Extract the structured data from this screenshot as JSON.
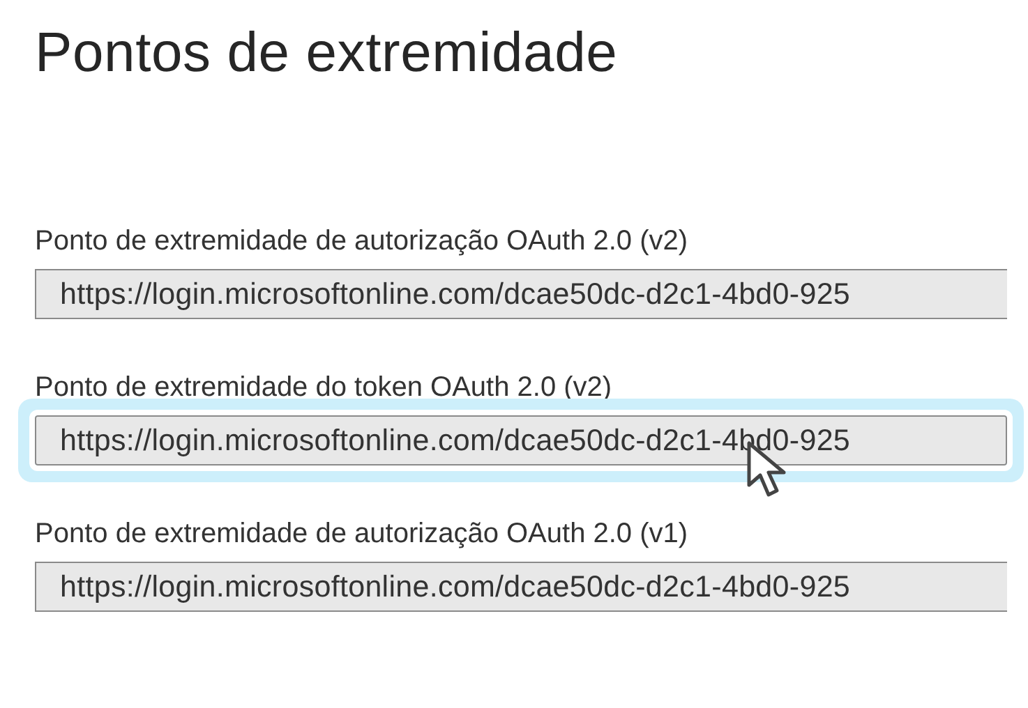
{
  "title": "Pontos de extremidade",
  "endpoints": [
    {
      "label": "Ponto de extremidade de autorização OAuth 2.0 (v2)",
      "value": "https://login.microsoftonline.com/dcae50dc-d2c1-4bd0-925",
      "focused": false
    },
    {
      "label": "Ponto de extremidade do token OAuth 2.0 (v2)",
      "value": "https://login.microsoftonline.com/dcae50dc-d2c1-4bd0-925",
      "focused": true
    },
    {
      "label": "Ponto de extremidade de autorização OAuth 2.0 (v1)",
      "value": "https://login.microsoftonline.com/dcae50dc-d2c1-4bd0-925",
      "focused": false
    }
  ]
}
